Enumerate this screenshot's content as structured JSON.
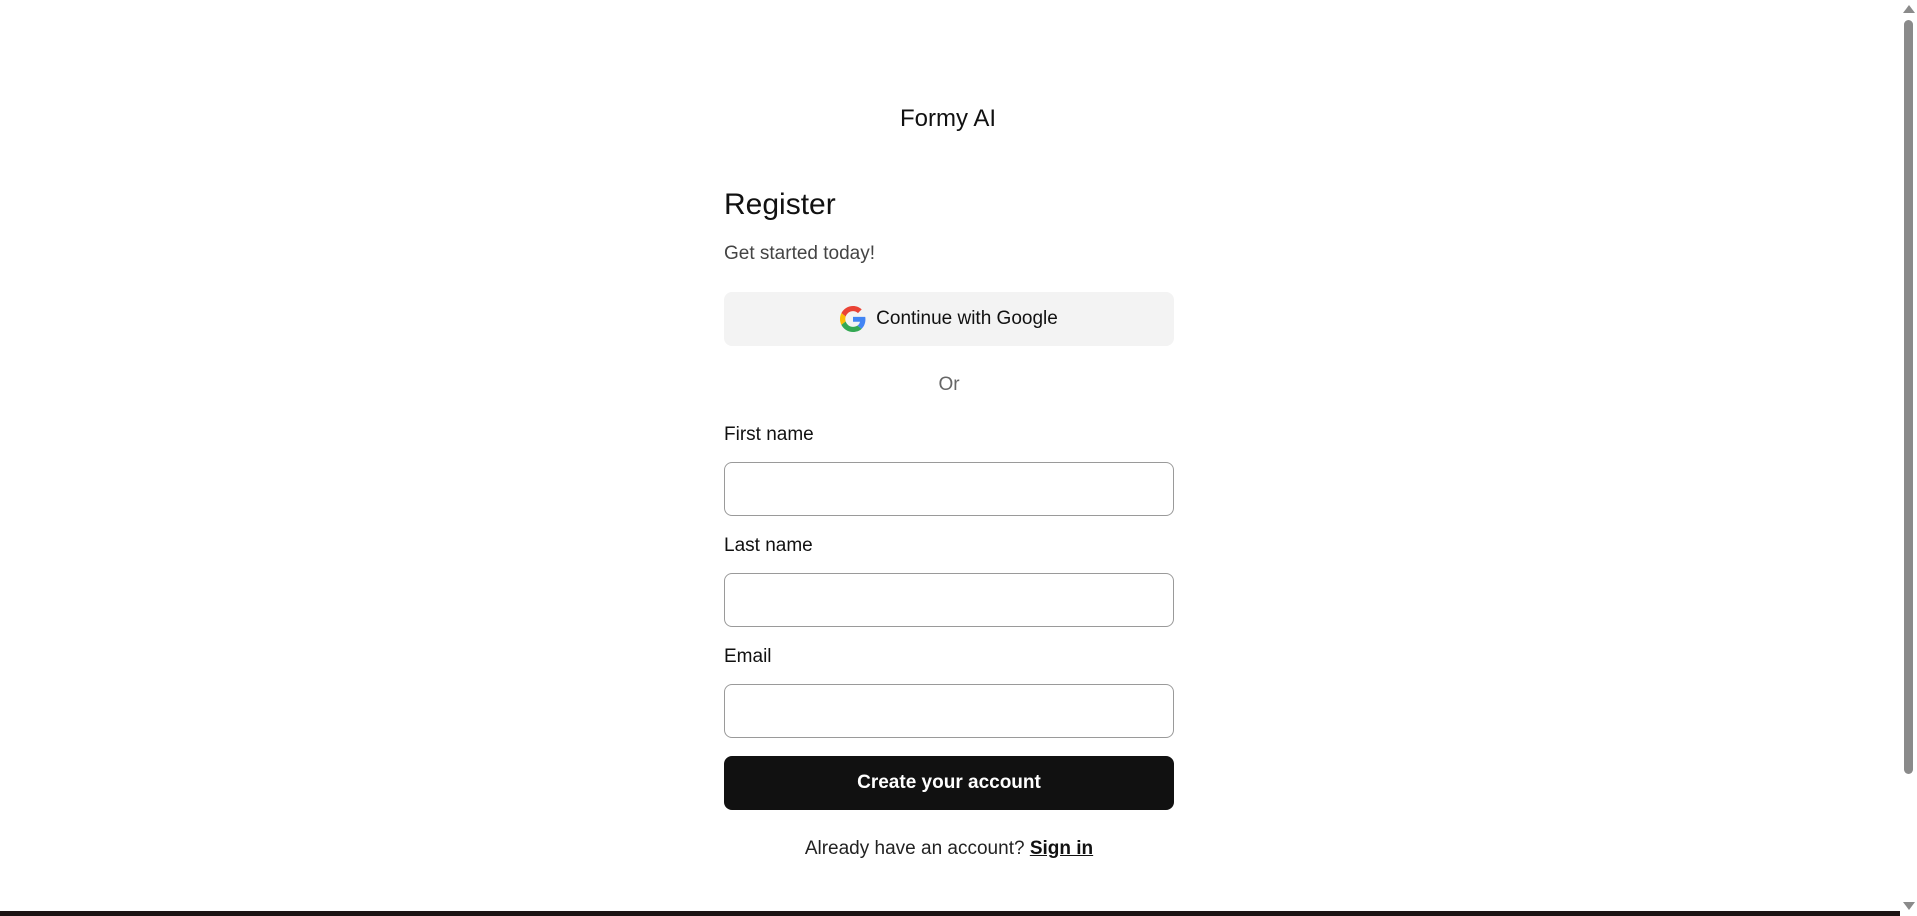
{
  "header": {
    "brand": "Formy AI"
  },
  "register": {
    "title": "Register",
    "subtitle": "Get started today!",
    "google_button_label": "Continue with Google",
    "google_icon": "google-g-icon",
    "divider_text": "Or",
    "fields": [
      {
        "label": "First name",
        "value": "",
        "placeholder": ""
      },
      {
        "label": "Last name",
        "value": "",
        "placeholder": ""
      },
      {
        "label": "Email",
        "value": "",
        "placeholder": ""
      }
    ],
    "submit_label": "Create your account",
    "signin_prompt": "Already have an account?",
    "signin_link": "Sign in"
  },
  "colors": {
    "primary_button": "#111111",
    "google_button_bg": "#f3f3f3",
    "input_border": "#9a9a9a",
    "muted_text": "#666666"
  }
}
